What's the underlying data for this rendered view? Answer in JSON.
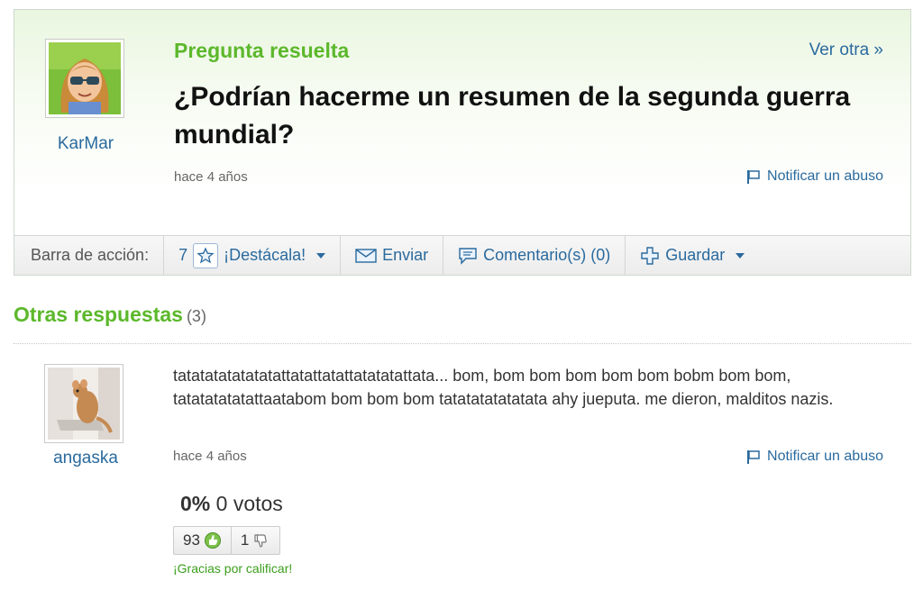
{
  "question": {
    "status": "Pregunta resuelta",
    "next_link": "Ver otra »",
    "title": "¿Podrían hacerme un resumen de la segunda guerra mundial?",
    "author": "KarMar",
    "time": "hace 4 años",
    "report": "Notificar un abuso"
  },
  "action_bar": {
    "label": "Barra de acción:",
    "star_count": "7",
    "star_label": "¡Destácala!",
    "send": "Enviar",
    "comments": "Comentario(s) (0)",
    "save": "Guardar"
  },
  "answers_section": {
    "title": "Otras respuestas",
    "count": "(3)"
  },
  "answer": {
    "author": "angaska",
    "text": "tatatatatatatatattatattatattatatatattata... bom, bom bom bom bom bom bobm bom bom, tatatatatatattaatabom bom bom bom tatatatatatatata ahy jueputa. me dieron, malditos nazis.",
    "time": "hace 4 años",
    "report": "Notificar un abuso",
    "rating_pct": "0%",
    "rating_votes": "0 votos",
    "thumbs_up": "93",
    "thumbs_down": "1",
    "thanks": "¡Gracias por calificar!"
  },
  "colors": {
    "green": "#5cb82b",
    "link": "#2a6a9e"
  }
}
